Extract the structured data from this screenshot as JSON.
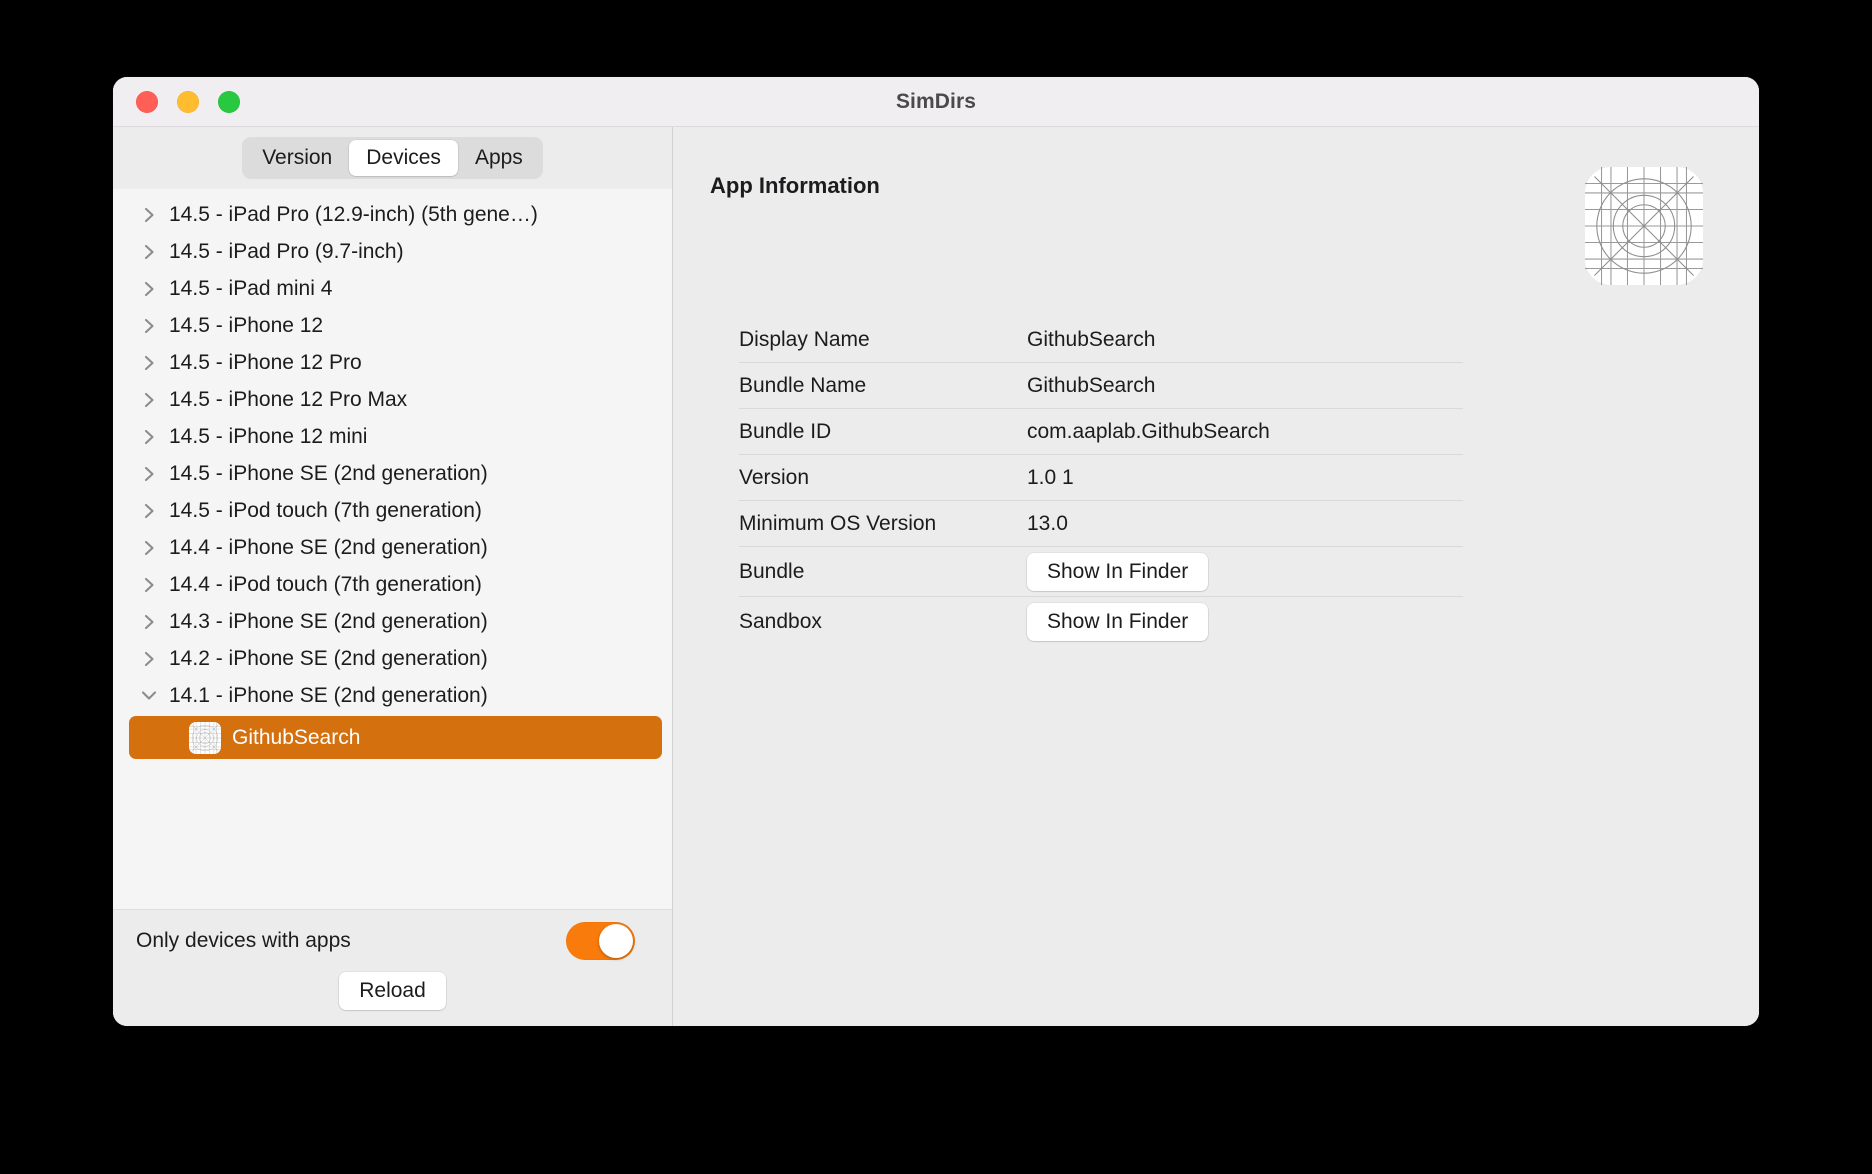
{
  "window": {
    "title": "SimDirs",
    "traffic_lights": [
      {
        "name": "close",
        "color": "#ff5f57"
      },
      {
        "name": "minimize",
        "color": "#febc2e"
      },
      {
        "name": "zoom",
        "color": "#28c840"
      }
    ]
  },
  "sidebar": {
    "segmented_control": {
      "options": [
        "Version",
        "Devices",
        "Apps"
      ],
      "selected": "Devices"
    },
    "devices": [
      {
        "label": "14.5 - iPad Pro (12.9-inch) (5th gene…)",
        "expanded": false
      },
      {
        "label": "14.5 - iPad Pro (9.7-inch)",
        "expanded": false
      },
      {
        "label": "14.5 - iPad mini 4",
        "expanded": false
      },
      {
        "label": "14.5 - iPhone 12",
        "expanded": false
      },
      {
        "label": "14.5 - iPhone 12 Pro",
        "expanded": false
      },
      {
        "label": "14.5 - iPhone 12 Pro Max",
        "expanded": false
      },
      {
        "label": "14.5 - iPhone 12 mini",
        "expanded": false
      },
      {
        "label": "14.5 - iPhone SE (2nd generation)",
        "expanded": false
      },
      {
        "label": "14.5 - iPod touch (7th generation)",
        "expanded": false
      },
      {
        "label": "14.4 - iPhone SE (2nd generation)",
        "expanded": false
      },
      {
        "label": "14.4 - iPod touch (7th generation)",
        "expanded": false
      },
      {
        "label": "14.3 - iPhone SE (2nd generation)",
        "expanded": false
      },
      {
        "label": "14.2 - iPhone SE (2nd generation)",
        "expanded": false
      },
      {
        "label": "14.1 - iPhone SE (2nd generation)",
        "expanded": true
      }
    ],
    "selected_app": {
      "label": "GithubSearch",
      "icon": "app-placeholder-icon",
      "highlight_color": "#d4700d"
    },
    "footer": {
      "toggle_label": "Only devices with apps",
      "toggle_on": true,
      "toggle_color": "#f97b0c",
      "reload_label": "Reload"
    }
  },
  "detail": {
    "title": "App Information",
    "app_icon": "app-placeholder-icon",
    "rows": [
      {
        "key": "Display Name",
        "value": "GithubSearch",
        "type": "text"
      },
      {
        "key": "Bundle Name",
        "value": "GithubSearch",
        "type": "text"
      },
      {
        "key": "Bundle ID",
        "value": "com.aaplab.GithubSearch",
        "type": "text"
      },
      {
        "key": "Version",
        "value": "1.0 1",
        "type": "text"
      },
      {
        "key": "Minimum OS Version",
        "value": "13.0",
        "type": "text"
      },
      {
        "key": "Bundle",
        "value": "Show In Finder",
        "type": "button"
      },
      {
        "key": "Sandbox",
        "value": "Show In Finder",
        "type": "button"
      }
    ]
  }
}
